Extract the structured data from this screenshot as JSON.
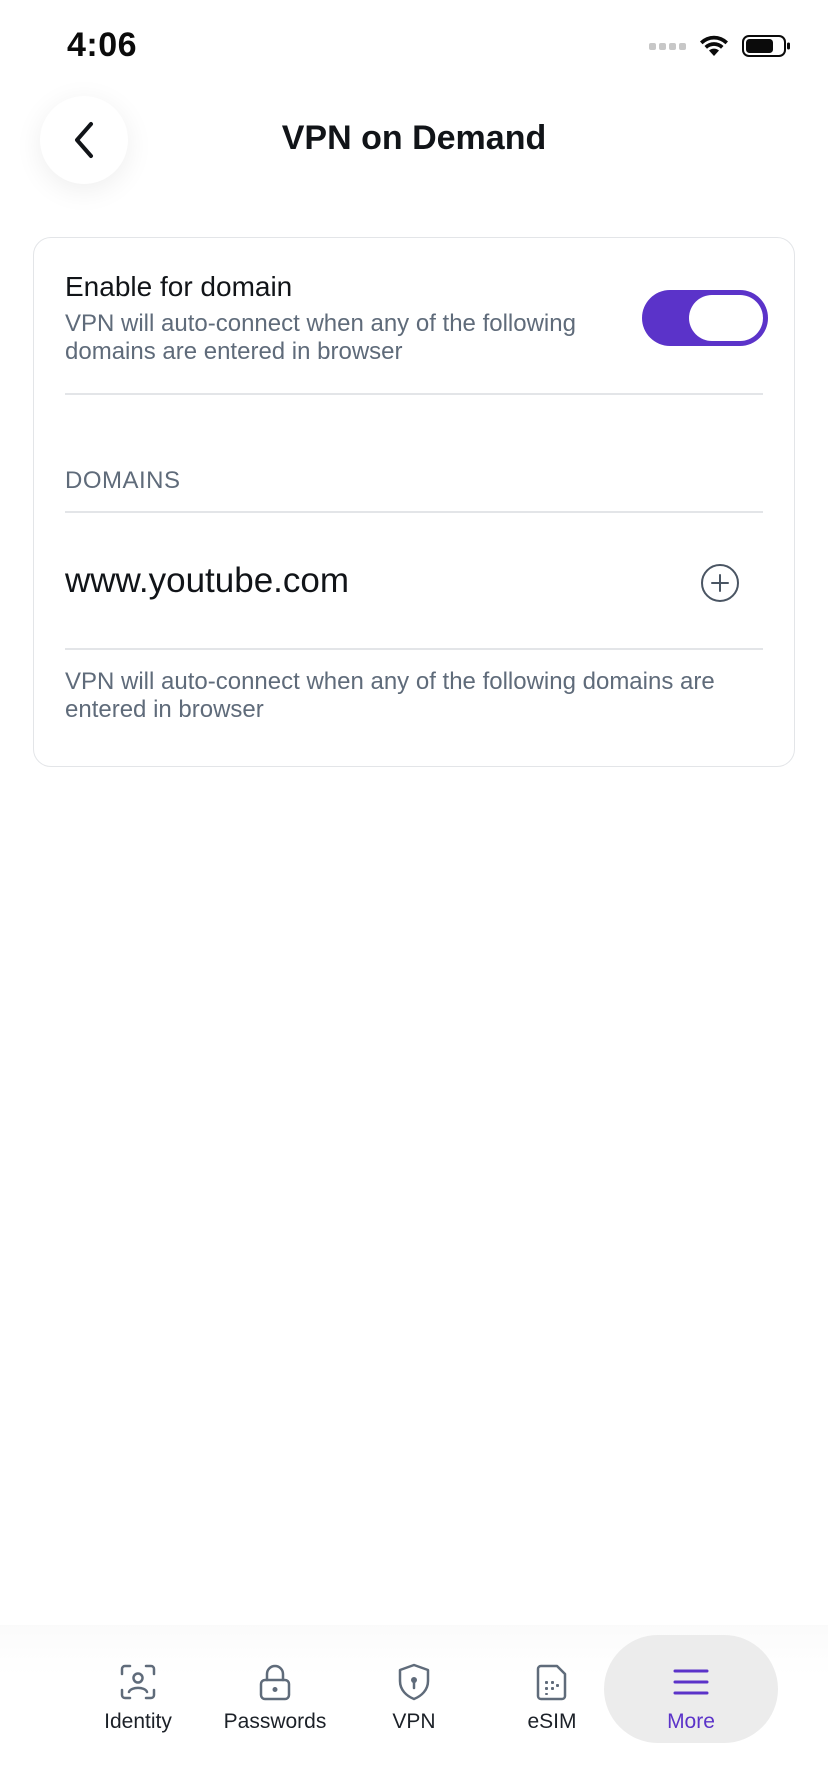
{
  "status_bar": {
    "time": "4:06"
  },
  "header": {
    "title": "VPN on Demand",
    "back_icon": "chevron-left-icon"
  },
  "enable_section": {
    "title": "Enable for domain",
    "description": "VPN will auto-connect when any of the following domains are entered in browser",
    "toggle_on": true
  },
  "domains": {
    "header": "DOMAINS",
    "value": "www.youtube.com",
    "add_icon": "plus-circle-icon",
    "note": "VPN will auto-connect when any of the following domains are entered in browser"
  },
  "bottom_nav": {
    "items": [
      {
        "label": "Identity",
        "icon": "identity-scan-icon",
        "active": false
      },
      {
        "label": "Passwords",
        "icon": "lock-icon",
        "active": false
      },
      {
        "label": "VPN",
        "icon": "shield-icon",
        "active": false
      },
      {
        "label": "eSIM",
        "icon": "sim-card-icon",
        "active": false
      },
      {
        "label": "More",
        "icon": "menu-icon",
        "active": true
      }
    ]
  },
  "colors": {
    "accent": "#5b33c9",
    "secondary_text": "#5f6b7a",
    "divider": "#e3e5e8"
  }
}
